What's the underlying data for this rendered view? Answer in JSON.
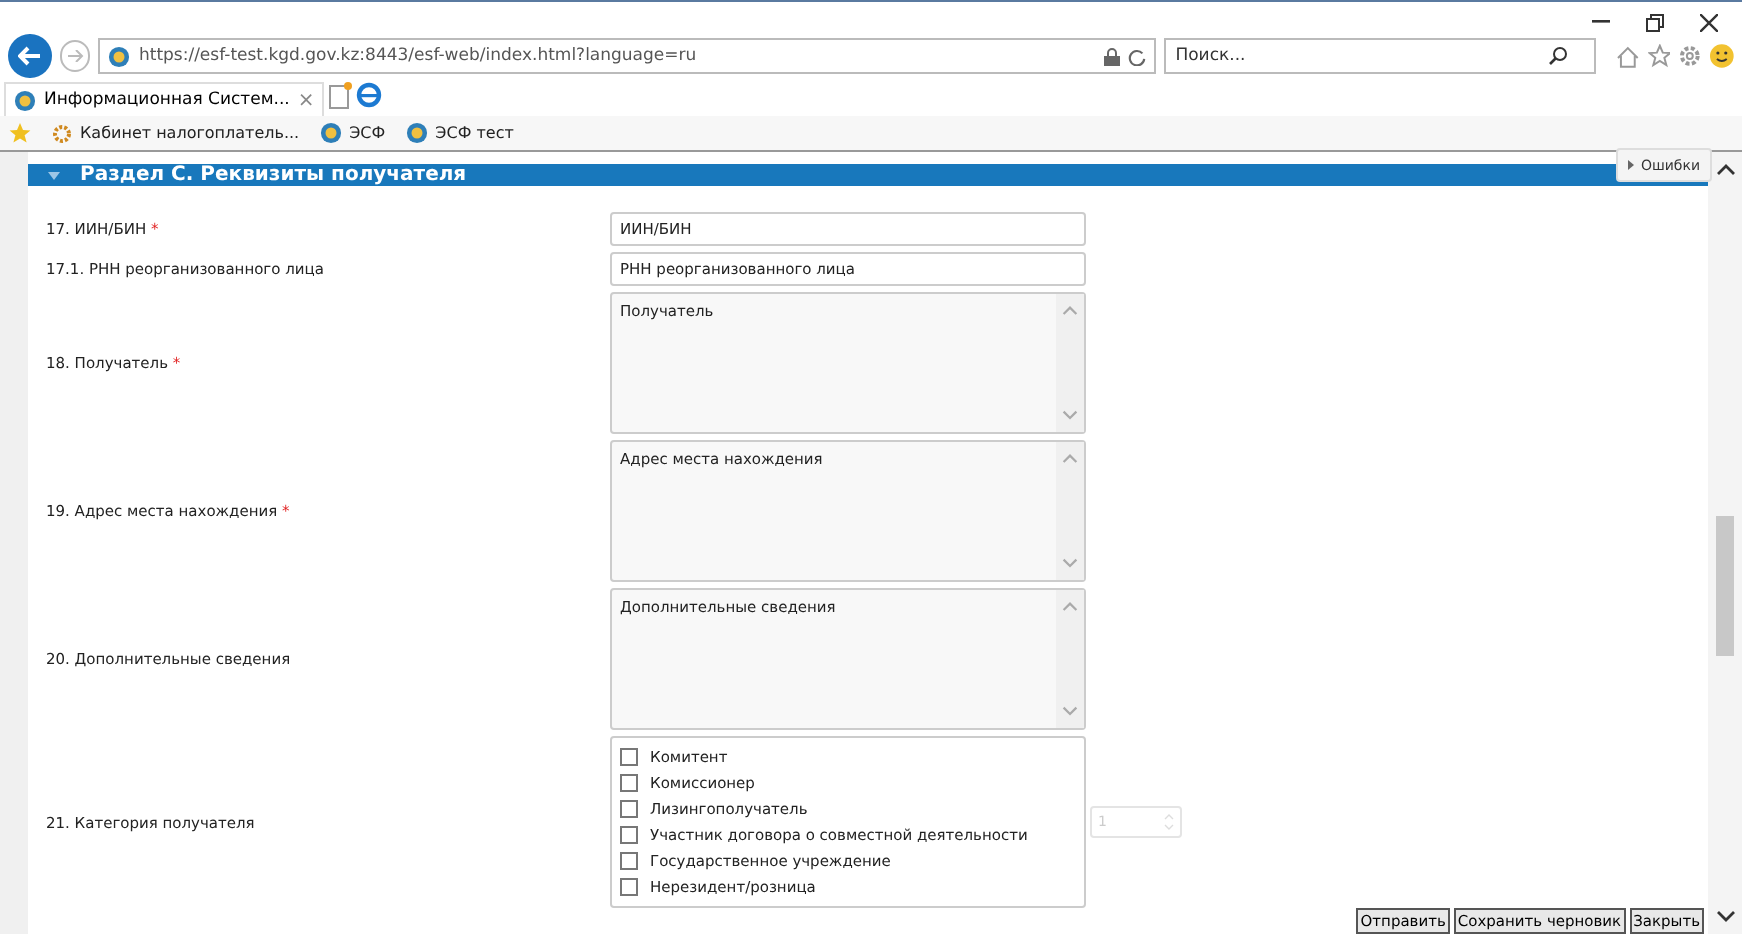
{
  "browser": {
    "address": "https://esf-test.kgd.gov.kz:8443/esf-web/index.html?language=ru",
    "search": {
      "placeholder": "Поиск..."
    },
    "tabs": [
      {
        "label": "Информационная Систем...",
        "close": "×",
        "selected": true
      }
    ],
    "favorites": [
      {
        "label": "Кабинет налогоплатель...",
        "kind": "gear"
      },
      {
        "label": "ЭСФ",
        "kind": "site"
      },
      {
        "label": "ЭСФ тест",
        "kind": "site"
      }
    ]
  },
  "section": {
    "title": "Раздел C. Реквизиты получателя",
    "expanded": true
  },
  "errors_tab": {
    "label": "Ошибки"
  },
  "required_marker": "*",
  "fields": [
    {
      "kind": "input",
      "label": "17. ИИН/БИН",
      "required": true,
      "placeholder": "ИИН/БИН"
    },
    {
      "kind": "input",
      "label": "17.1. РНН реорганизованного лица",
      "required": false,
      "placeholder": "РНН реорганизованного лица"
    },
    {
      "kind": "textarea",
      "label": "18. Получатель",
      "required": true,
      "placeholder": "Получатель"
    },
    {
      "kind": "textarea",
      "label": "19. Адрес места нахождения",
      "required": true,
      "placeholder": "Адрес места нахождения"
    },
    {
      "kind": "textarea",
      "label": "20. Дополнительные сведения",
      "required": false,
      "placeholder": "Дополнительные сведения"
    },
    {
      "kind": "checklist",
      "label": "21. Категория получателя",
      "required": false,
      "options": [
        {
          "label": "Комитент",
          "checked": false
        },
        {
          "label": "Комиссионер",
          "checked": false
        },
        {
          "label": "Лизингополучатель",
          "checked": false
        },
        {
          "label": "Участник договора о совместной деятельности",
          "checked": false
        },
        {
          "label": "Государственное учреждение",
          "checked": false
        },
        {
          "label": "Нерезидент/розница",
          "checked": false
        }
      ],
      "spinner": {
        "value": "1",
        "disabled": true
      }
    }
  ],
  "buttons": [
    "Отправить",
    "Сохранить черновик",
    "Закрыть"
  ]
}
